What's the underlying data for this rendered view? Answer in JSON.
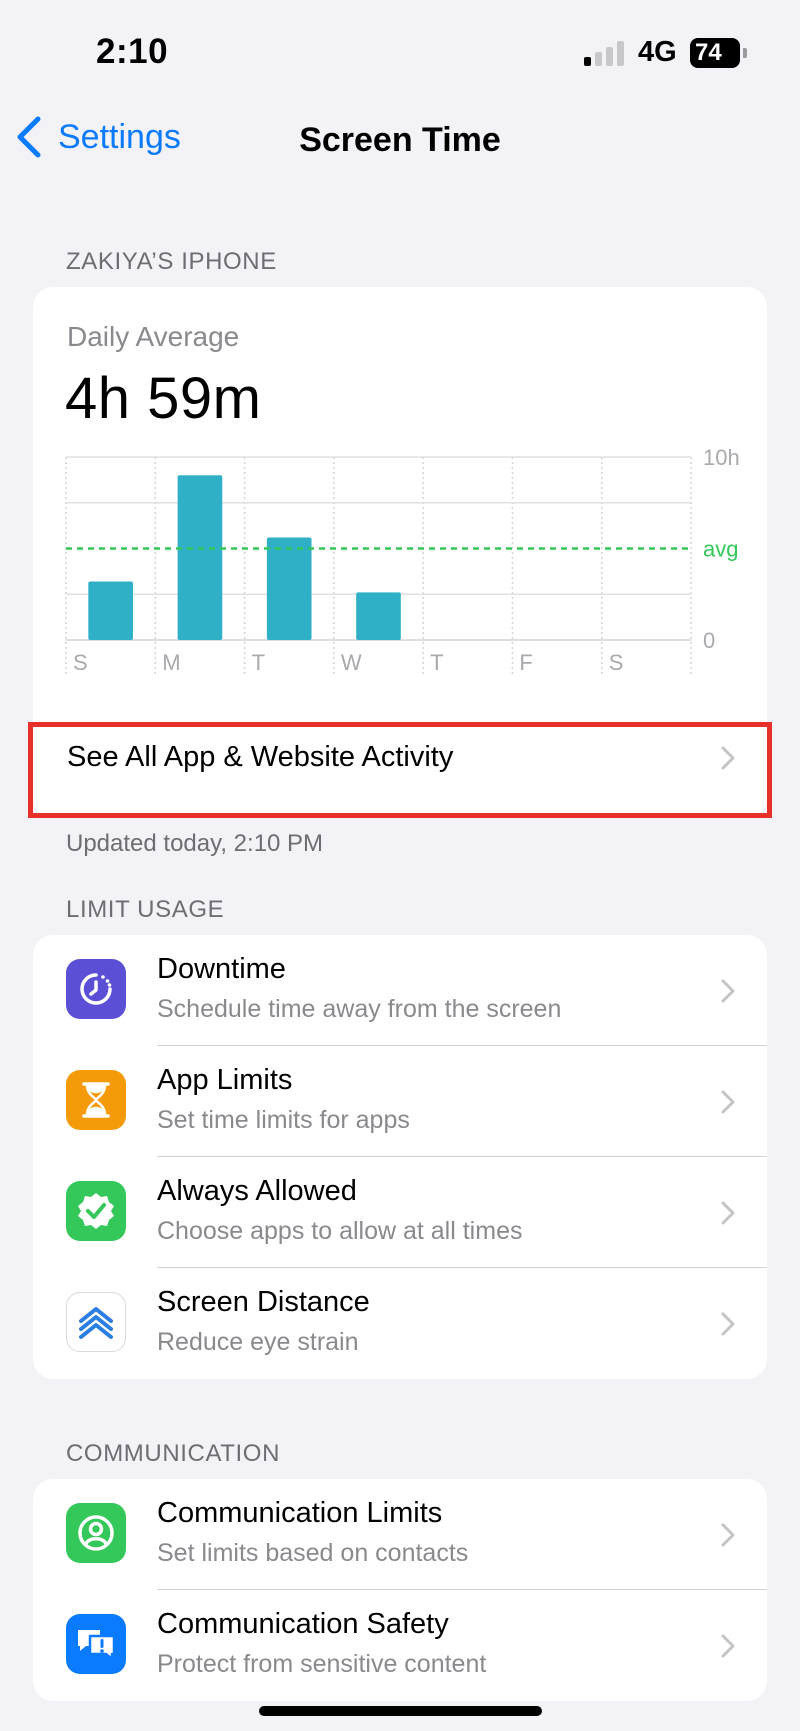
{
  "status_bar": {
    "time": "2:10",
    "network": "4G",
    "battery": "74"
  },
  "nav": {
    "back_label": "Settings",
    "title": "Screen Time"
  },
  "device_section": {
    "header": "ZAKIYA’S IPHONE"
  },
  "summary": {
    "label": "Daily Average",
    "value": "4h 59m"
  },
  "chart_data": {
    "type": "bar",
    "categories": [
      "S",
      "M",
      "T",
      "W",
      "T",
      "F",
      "S"
    ],
    "values": [
      3.2,
      9.0,
      5.6,
      2.6,
      0,
      0,
      0
    ],
    "ylim": [
      0,
      10
    ],
    "y_ticks": [
      "10h",
      "avg",
      "0"
    ],
    "average": 5.0,
    "bar_color": "#30b0c7",
    "avg_color": "#34c759",
    "grid": true
  },
  "activity_row": {
    "label": "See All App & Website Activity",
    "highlight_color": "#e8302b"
  },
  "updated_text": "Updated today, 2:10 PM",
  "limit_usage": {
    "header": "LIMIT USAGE",
    "items": [
      {
        "title": "Downtime",
        "subtitle": "Schedule time away from the screen",
        "icon": "downtime-icon",
        "color": "#5b4fd6"
      },
      {
        "title": "App Limits",
        "subtitle": "Set time limits for apps",
        "icon": "hourglass-icon",
        "color": "#f59b0a"
      },
      {
        "title": "Always Allowed",
        "subtitle": "Choose apps to allow at all times",
        "icon": "checkmark-seal-icon",
        "color": "#34c759"
      },
      {
        "title": "Screen Distance",
        "subtitle": "Reduce eye strain",
        "icon": "chevrons-up-icon",
        "color": "#ffffff"
      }
    ]
  },
  "communication": {
    "header": "COMMUNICATION",
    "items": [
      {
        "title": "Communication Limits",
        "subtitle": "Set limits based on contacts",
        "icon": "person-circle-icon",
        "color": "#34c759"
      },
      {
        "title": "Communication Safety",
        "subtitle": "Protect from sensitive content",
        "icon": "message-alert-icon",
        "color": "#0a7aff"
      }
    ]
  }
}
